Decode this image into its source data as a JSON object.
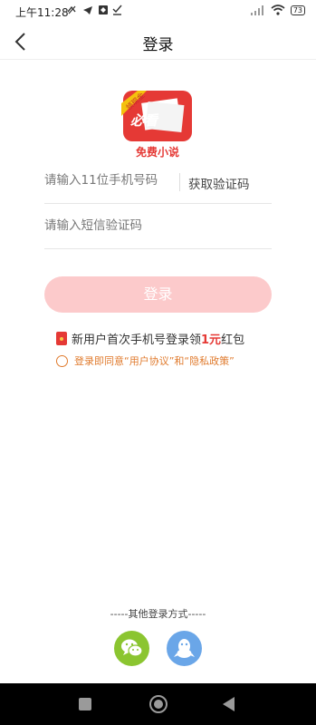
{
  "status_bar": {
    "time": "上午11:28",
    "battery": "73"
  },
  "header": {
    "title": "登录"
  },
  "logo": {
    "badge": "领现金",
    "brand": "必看",
    "subtitle": "免费小说"
  },
  "form": {
    "phone_placeholder": "请输入11位手机号码",
    "get_code_label": "获取验证码",
    "sms_placeholder": "请输入短信验证码",
    "login_label": "登录"
  },
  "promo": {
    "text_before": "新用户首次手机号登录领",
    "amount": "1元",
    "text_after": "红包"
  },
  "agreement": {
    "prefix": "登录即同意",
    "user_agreement": "“用户协议”",
    "and": "和",
    "privacy_policy": "“隐私政策”"
  },
  "other_login": {
    "label": "-----其他登录方式-----"
  },
  "colors": {
    "accent": "#fccacb",
    "agreement": "#e07b2e",
    "promo_red": "#e53935",
    "wechat": "#8bc530",
    "qq": "#6aa6e8"
  }
}
